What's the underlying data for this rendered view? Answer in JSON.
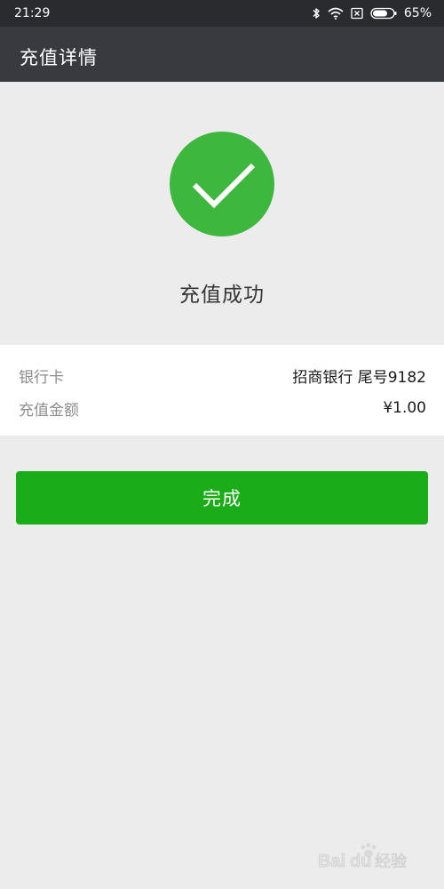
{
  "status_bar": {
    "time": "21:29",
    "battery_percent": "65%",
    "icons": [
      "bluetooth-icon",
      "wifi-icon",
      "sim-off-icon",
      "battery-icon"
    ]
  },
  "header": {
    "title": "充值详情"
  },
  "result": {
    "icon": "checkmark-icon",
    "status_text": "充值成功",
    "accent_color": "#3eb73f"
  },
  "details": [
    {
      "label": "银行卡",
      "value": "招商银行 尾号9182"
    },
    {
      "label": "充值金额",
      "value": "¥1.00"
    }
  ],
  "done_button": {
    "label": "完成",
    "color": "#1aad19"
  },
  "watermark": {
    "text": "Baidu经验",
    "icon": "paw-logo"
  }
}
